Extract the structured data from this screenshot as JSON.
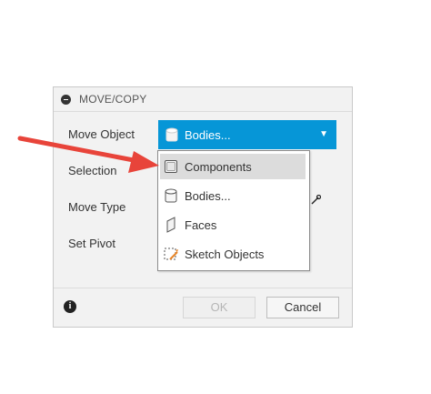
{
  "dialog": {
    "title": "MOVE/COPY",
    "rows": {
      "move_object": "Move Object",
      "selection": "Selection",
      "move_type": "Move Type",
      "set_pivot": "Set Pivot"
    },
    "move_object_select": {
      "value": "Bodies...",
      "icon": "body-cube-icon",
      "bg_color": "#0696d7"
    },
    "buttons": {
      "ok": "OK",
      "cancel": "Cancel"
    }
  },
  "dropdown": {
    "options": [
      {
        "label": "Components",
        "icon": "component-cube-icon",
        "highlighted": true
      },
      {
        "label": "Bodies...",
        "icon": "body-cube-icon"
      },
      {
        "label": "Faces",
        "icon": "face-icon"
      },
      {
        "label": "Sketch Objects",
        "icon": "sketch-objects-icon"
      }
    ]
  },
  "annotation": {
    "arrow_color": "#e8443a",
    "icon": "pointer-arrow"
  }
}
